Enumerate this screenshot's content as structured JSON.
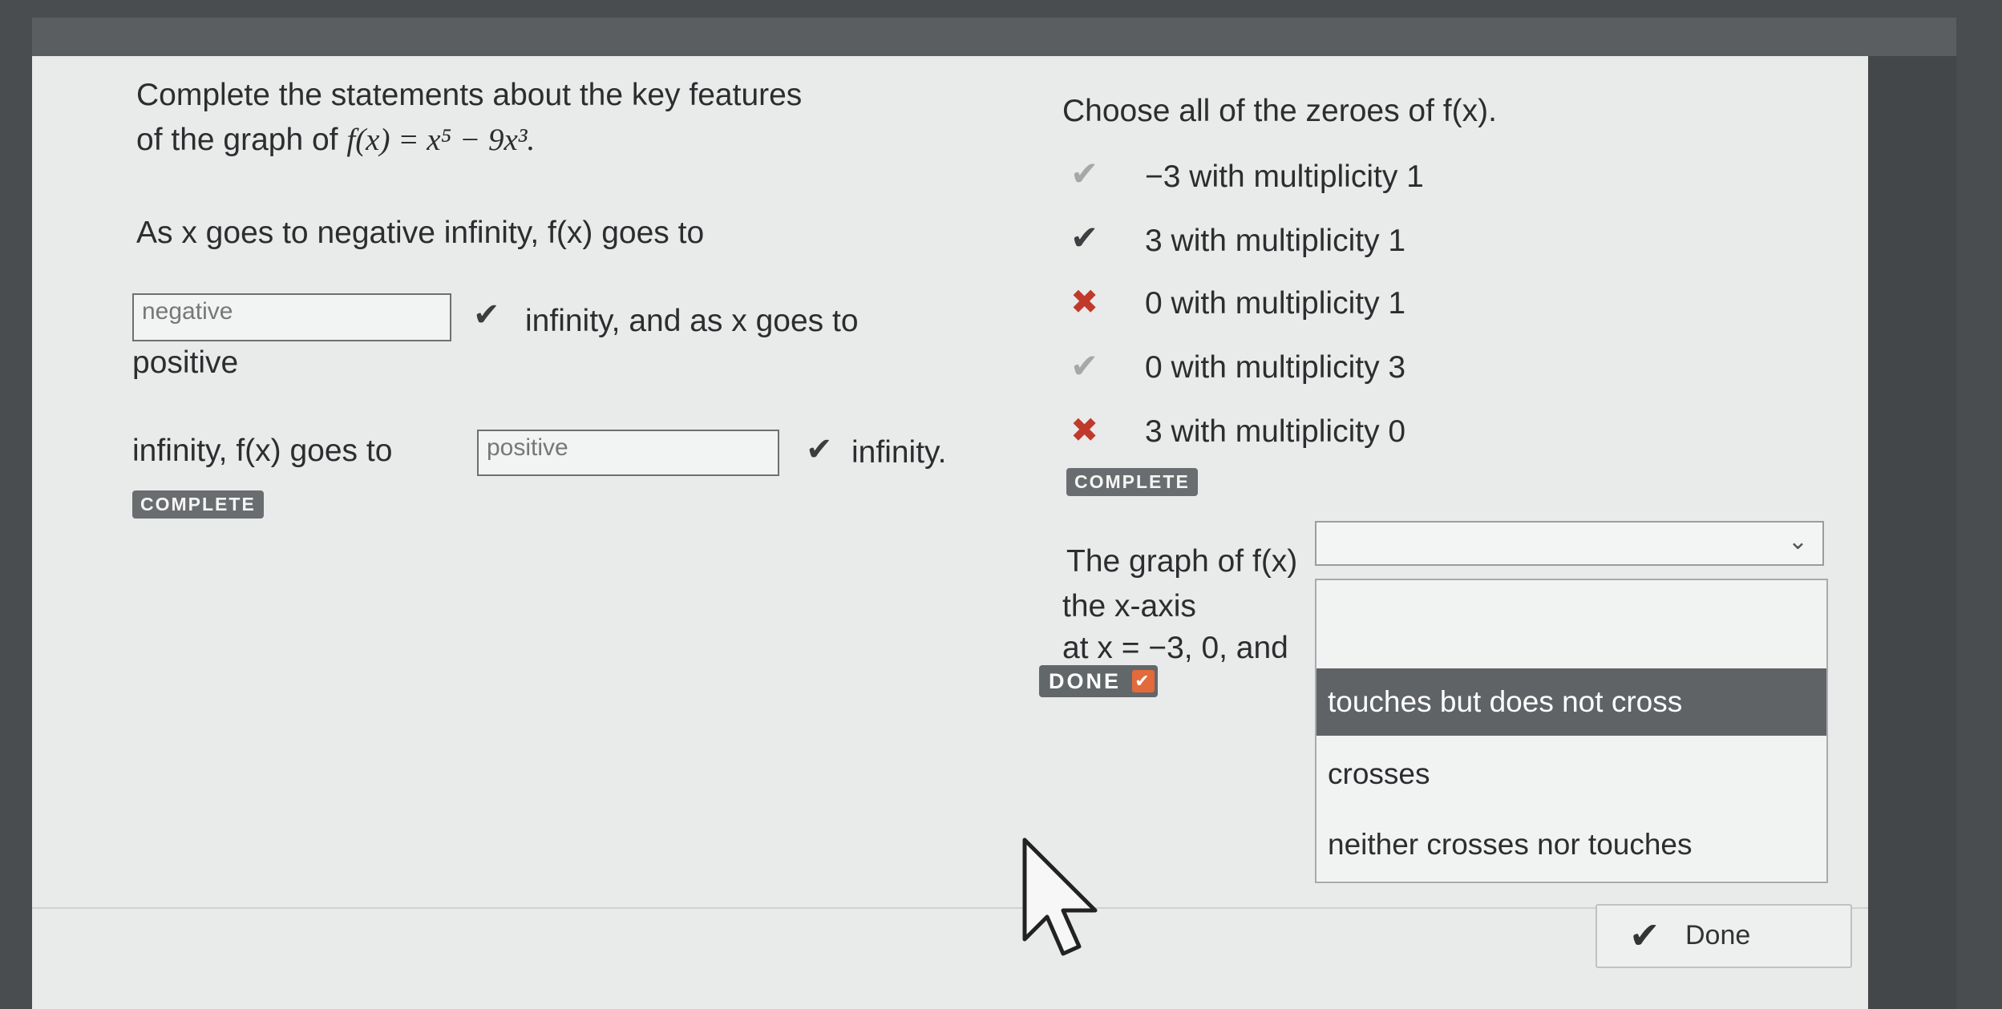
{
  "left": {
    "intro_line1": "Complete the statements about the key features",
    "intro_line2_prefix": "of the graph of ",
    "function_expr": "f(x) = x⁵ − 9x³.",
    "q1_prefix": "As x goes to negative infinity, f(x) goes to",
    "answer1": "negative",
    "q1_suffix": "infinity, and as x goes to",
    "q2_prefix": "positive",
    "q2_line": "infinity, f(x) goes to",
    "answer2": "positive",
    "q2_suffix": "infinity.",
    "badge": "COMPLETE"
  },
  "zeroes": {
    "prompt": "Choose all of the zeroes of f(x).",
    "options": [
      {
        "label": "−3 with multiplicity 1",
        "mark": "check-faint"
      },
      {
        "label": "3 with multiplicity 1",
        "mark": "check"
      },
      {
        "label": "0 with multiplicity 1",
        "mark": "x"
      },
      {
        "label": "0 with multiplicity 3",
        "mark": "check-faint"
      },
      {
        "label": "3 with multiplicity 0",
        "mark": "x"
      }
    ],
    "badge": "COMPLETE"
  },
  "graph_statement": {
    "line1": "The graph of f(x)",
    "line2": "the x-axis",
    "line3": "at x = −3, 0, and",
    "select_value": "",
    "dropdown_options": [
      "touches but does not cross",
      "crosses",
      "neither crosses nor touches"
    ],
    "highlighted_option": 0,
    "done_badge": "DONE"
  },
  "footer": {
    "done_label": "Done"
  },
  "icons": {
    "check": "✔",
    "cross": "✖",
    "chevron": "⌄"
  }
}
